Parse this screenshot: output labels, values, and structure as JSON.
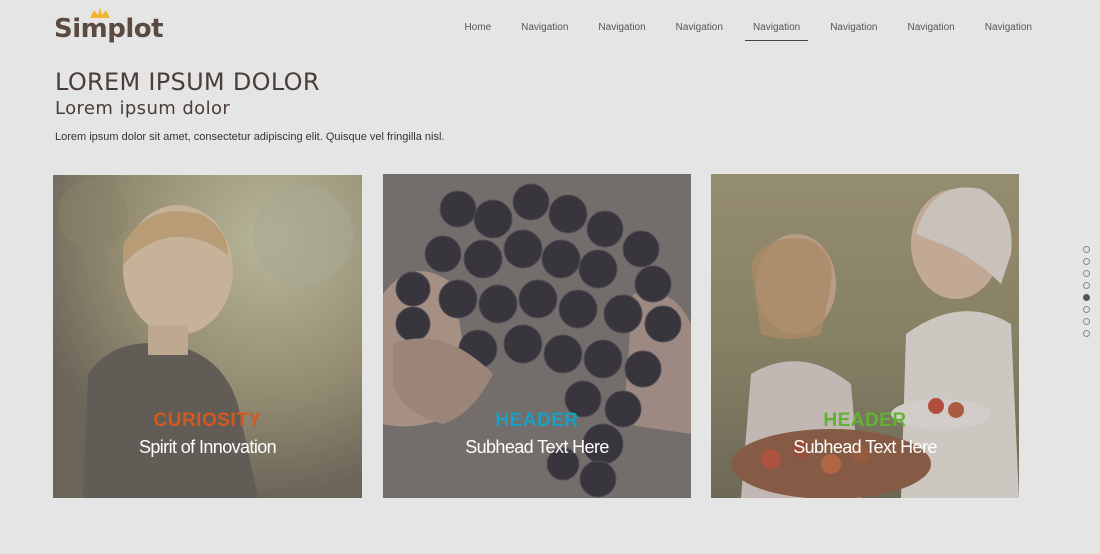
{
  "brand": {
    "name": "Simplot",
    "logo_icon": "sun-crown-icon",
    "accent": "#f2b632"
  },
  "nav": {
    "items": [
      {
        "label": "Home",
        "active": false
      },
      {
        "label": "Navigation",
        "active": false
      },
      {
        "label": "Navigation",
        "active": false
      },
      {
        "label": "Navigation",
        "active": false
      },
      {
        "label": "Navigation",
        "active": true
      },
      {
        "label": "Navigation",
        "active": false
      },
      {
        "label": "Navigation",
        "active": false
      },
      {
        "label": "Navigation",
        "active": false
      }
    ]
  },
  "hero": {
    "title": "LOREM IPSUM DOLOR",
    "subtitle": "Lorem ipsum dolor",
    "text": "Lorem ipsum dolor sit amet, consectetur adipiscing elit. Quisque vel fringilla nisl."
  },
  "cards": [
    {
      "header": "CURIOSITY",
      "subhead": "Spirit of Innovation",
      "header_color": "#d4581e",
      "image": "boy-looking-up-photo"
    },
    {
      "header": "HEADER",
      "subhead": "Subhead Text Here",
      "header_color": "#1aa0c2",
      "image": "hand-holding-grapes-photo"
    },
    {
      "header": "HEADER",
      "subhead": "Subhead Text Here",
      "header_color": "#63b233",
      "image": "family-picnic-photo"
    }
  ],
  "pager": {
    "count": 8,
    "active_index": 4
  }
}
